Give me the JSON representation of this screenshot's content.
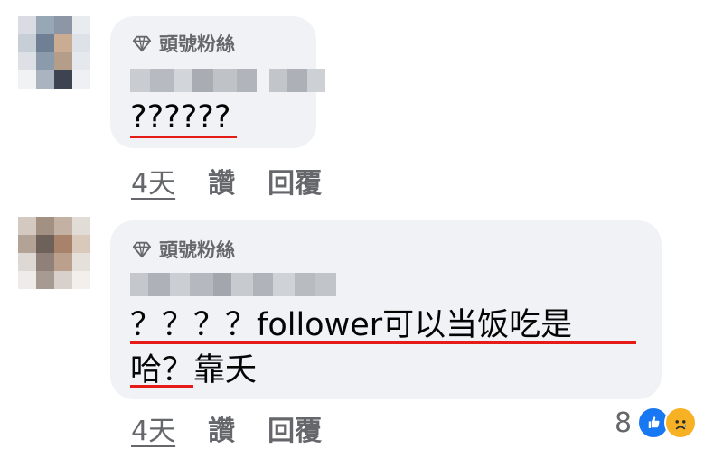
{
  "comments": [
    {
      "badge": "頭號粉絲",
      "text": "??????",
      "actions": {
        "time": "4天",
        "like": "讚",
        "reply": "回覆"
      }
    },
    {
      "badge": "頭號粉絲",
      "text_line1": "？？？？follower可以当饭吃是",
      "text_line2": "哈？靠夭",
      "actions": {
        "time": "4天",
        "like": "讚",
        "reply": "回覆"
      },
      "reactions": {
        "count": "8",
        "types": [
          "like-icon",
          "sad-icon"
        ]
      }
    }
  ],
  "colors": {
    "bubble": "#f0f2f5",
    "meta": "#65676b",
    "underline": "#e41b17",
    "like": "#1877f2",
    "sad": "#f7b125"
  }
}
